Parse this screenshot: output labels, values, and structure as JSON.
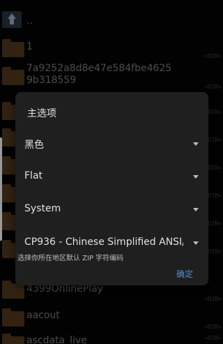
{
  "file_list": {
    "items": [
      {
        "name": "1",
        "tag": "<DIR>"
      },
      {
        "name": "7a9252a8d8e47e584fbe4625",
        "tag": "<DIR>"
      },
      {
        "name": "9b318559",
        "tag": ""
      },
      {
        "name": "4399OnlinePlay",
        "tag": "<DIR>"
      },
      {
        "name": "aacout",
        "tag": "<DIR>"
      },
      {
        "name": "ascdata_live",
        "tag": "<DIR>"
      }
    ],
    "side_tags": [
      "<DIR>",
      "<DIR>",
      "<DIR>",
      "<DIR>",
      "<DIR>",
      "<DIR>",
      "<DIR>",
      "<DIR>",
      "<DIR>",
      "<DIR>",
      "<DIR>",
      "<DIR>"
    ]
  },
  "dialog": {
    "title": "主选项",
    "options": [
      {
        "value": "黑色"
      },
      {
        "value": "Flat"
      },
      {
        "value": "System"
      },
      {
        "value": "CP936 - Chinese Simplified ANSI/..."
      }
    ],
    "hint": "选择你所在地区默认 ZIP 字符编码",
    "ok_label": "确定"
  },
  "icons": {
    "up": "arrow-up-icon",
    "folder": "folder-icon",
    "dropdown": "chevron-down-icon"
  },
  "colors": {
    "background": "#050505",
    "dialog": "#1f1f1f",
    "accent": "#4f8fd4",
    "folder": "#5a3f22"
  }
}
